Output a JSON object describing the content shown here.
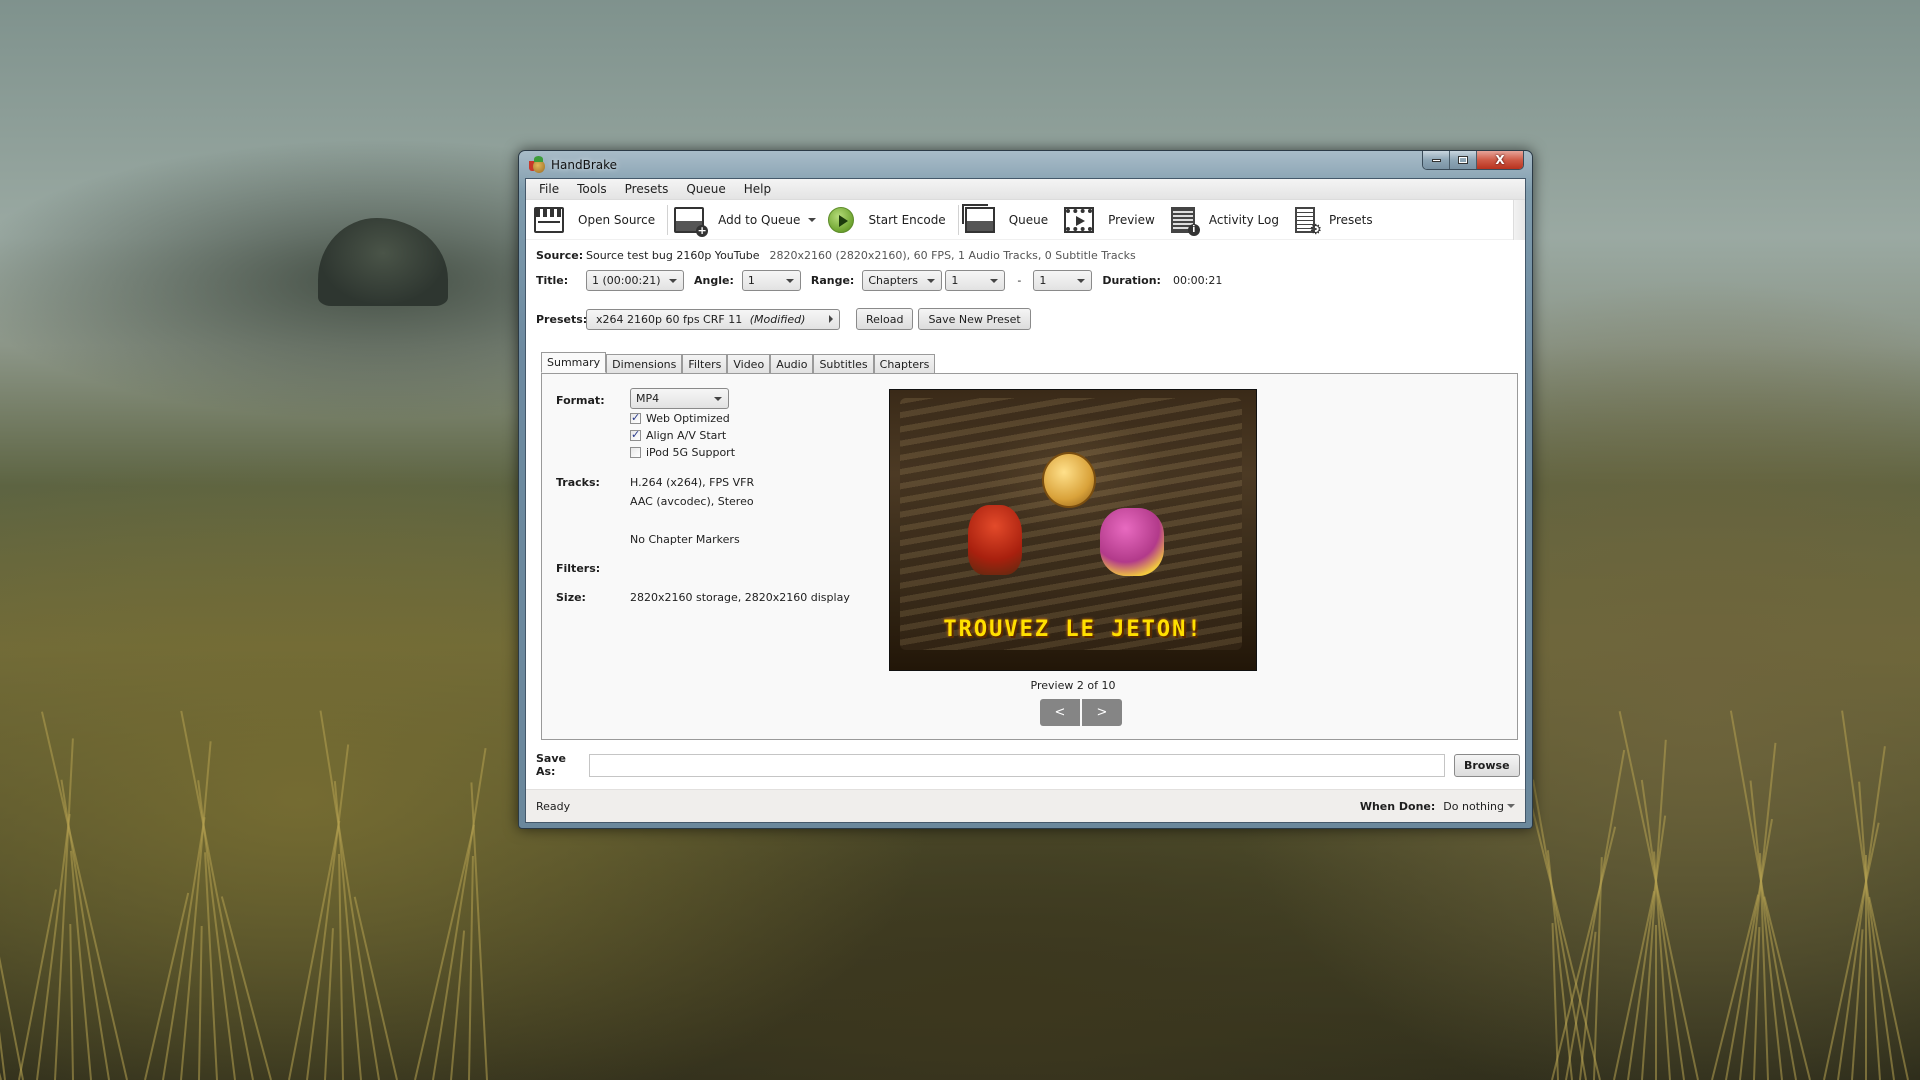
{
  "window": {
    "title": "HandBrake",
    "caption_buttons": [
      "minimize",
      "maximize",
      "close"
    ],
    "close_glyph": "X"
  },
  "menu": [
    "File",
    "Tools",
    "Presets",
    "Queue",
    "Help"
  ],
  "toolbar": {
    "open_source": "Open Source",
    "add_to_queue": "Add to Queue",
    "start_encode": "Start Encode",
    "queue": "Queue",
    "preview": "Preview",
    "activity_log": "Activity Log",
    "presets": "Presets"
  },
  "source": {
    "label": "Source:",
    "name": "Source test bug 2160p YouTube",
    "details": "2820x2160 (2820x2160), 60 FPS, 1 Audio Tracks, 0 Subtitle Tracks"
  },
  "title_row": {
    "title_label": "Title:",
    "title_value": "1 (00:00:21)",
    "angle_label": "Angle:",
    "angle_value": "1",
    "range_label": "Range:",
    "range_mode": "Chapters",
    "range_start": "1",
    "range_sep": "-",
    "range_end": "1",
    "duration_label": "Duration:",
    "duration_value": "00:00:21"
  },
  "presets_row": {
    "label": "Presets:",
    "preset_name": "x264 2160p 60 fps CRF 11",
    "preset_modified": "(Modified)",
    "reload": "Reload",
    "save_new_preset": "Save New Preset"
  },
  "tabs": [
    {
      "label": "Summary",
      "active": true
    },
    {
      "label": "Dimensions",
      "active": false
    },
    {
      "label": "Filters",
      "active": false
    },
    {
      "label": "Video",
      "active": false
    },
    {
      "label": "Audio",
      "active": false
    },
    {
      "label": "Subtitles",
      "active": false
    },
    {
      "label": "Chapters",
      "active": false
    }
  ],
  "summary": {
    "format_label": "Format:",
    "format_value": "MP4",
    "options": [
      {
        "label": "Web Optimized",
        "checked": true
      },
      {
        "label": "Align A/V Start",
        "checked": true
      },
      {
        "label": "iPod 5G Support",
        "checked": false
      }
    ],
    "tracks_label": "Tracks:",
    "tracks": [
      "H.264 (x264),  FPS VFR",
      "AAC (avcodec), Stereo"
    ],
    "chapters": "No Chapter Markers",
    "filters_label": "Filters:",
    "filters_value": "",
    "size_label": "Size:",
    "size_value": "2820x2160 storage, 2820x2160 display",
    "preview_caption_text": "TROUVEZ LE JETON!",
    "preview_label": "Preview 2 of 10",
    "prev_button": "<",
    "next_button": ">"
  },
  "save_as": {
    "label": "Save As:",
    "value": "",
    "browse": "Browse"
  },
  "status": {
    "text": "Ready",
    "when_done_label": "When Done:",
    "when_done_value": "Do nothing"
  }
}
